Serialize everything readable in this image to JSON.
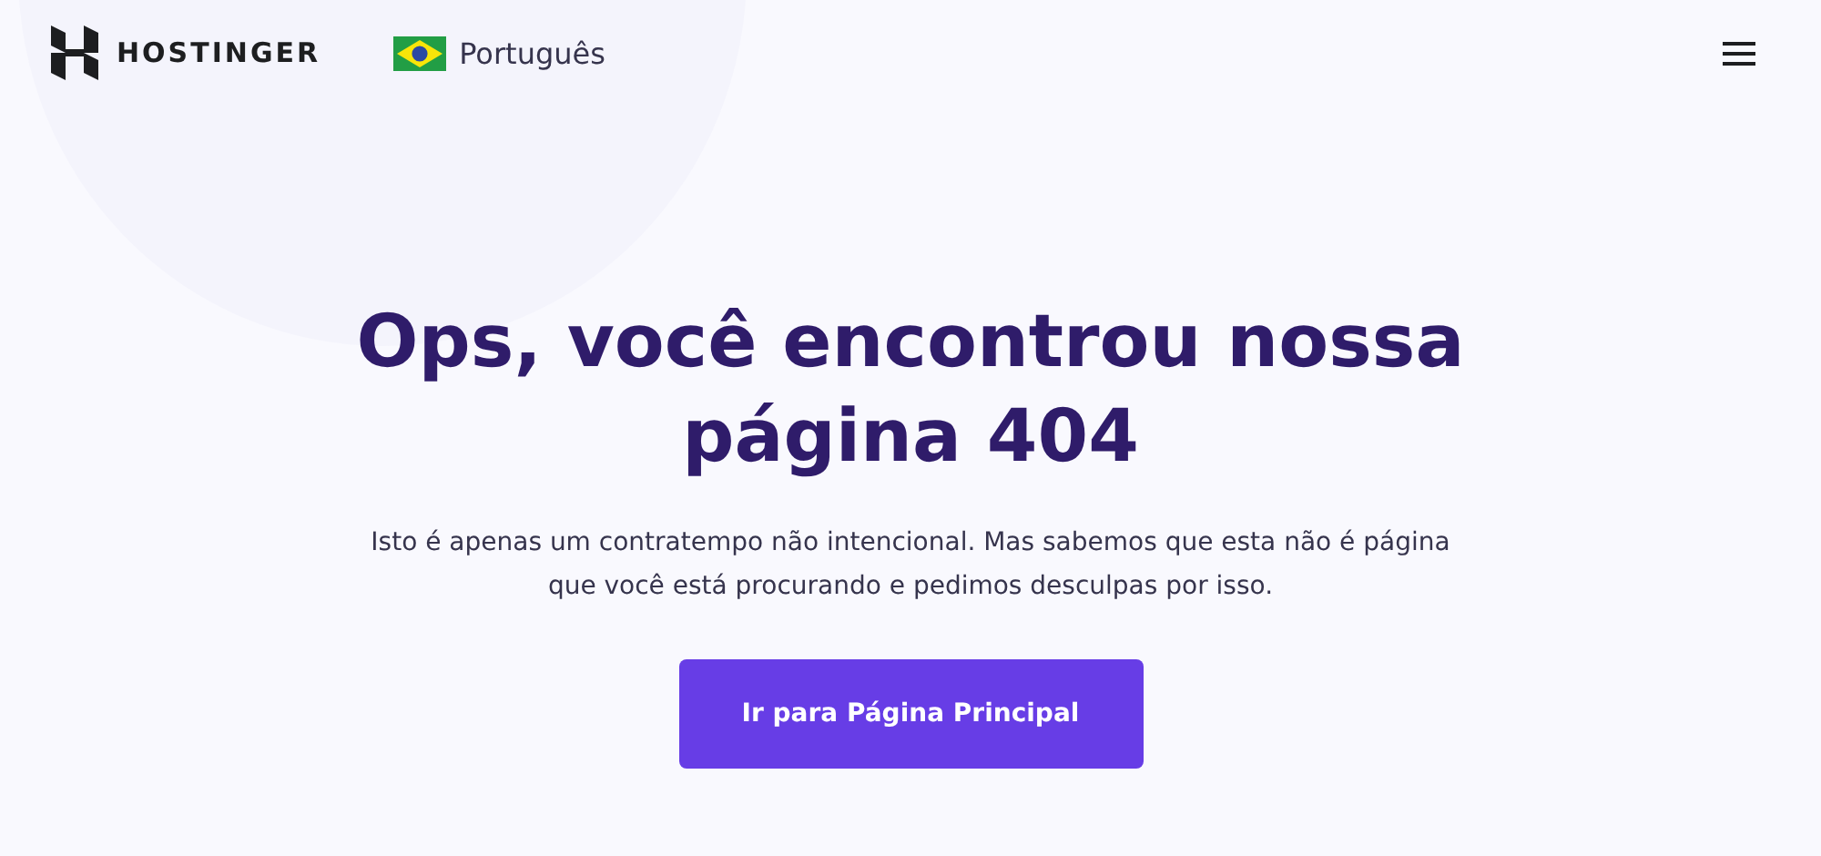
{
  "header": {
    "logo": "HOSTINGER",
    "language": "Português"
  },
  "hero": {
    "title": "Ops, você encontrou nossa página 404",
    "description": "Isto é apenas um contratempo não intencional. Mas sabemos que esta não é página que você está procurando e pedimos desculpas por isso.",
    "button": "Ir para Página Principal"
  }
}
